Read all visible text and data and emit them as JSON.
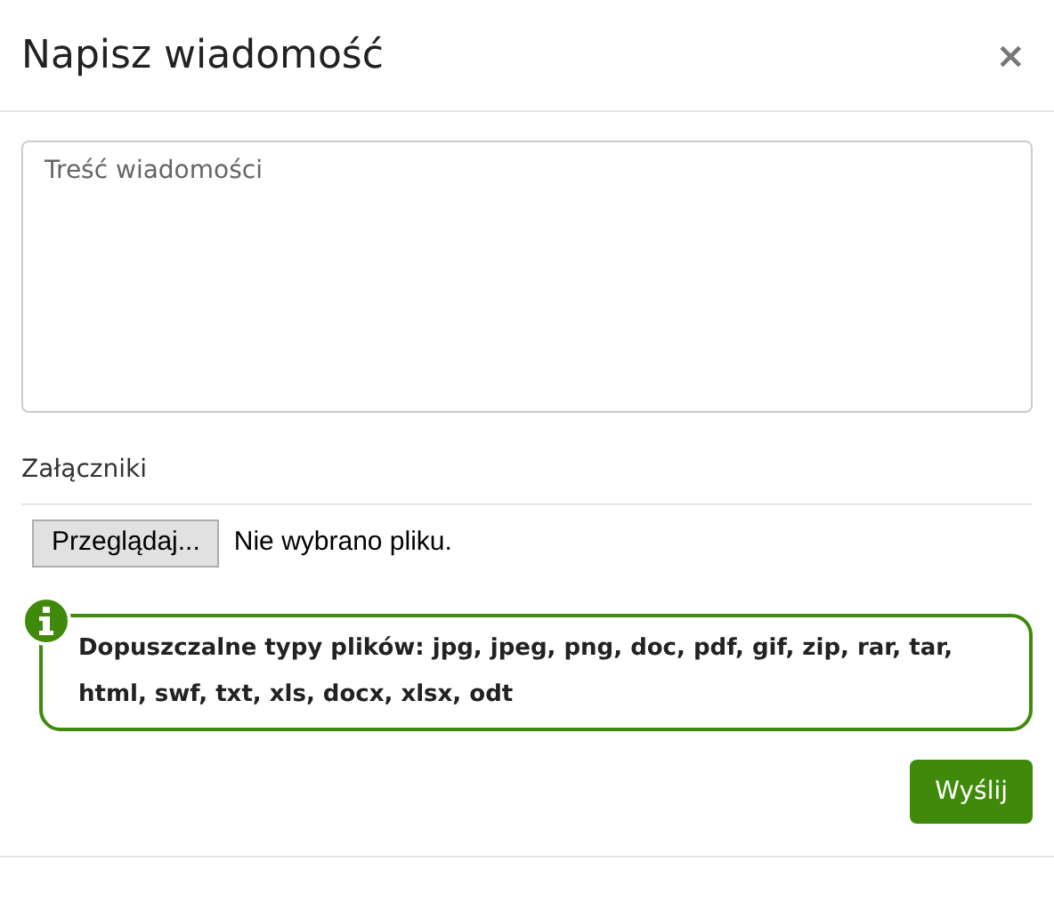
{
  "dialog": {
    "title": "Napisz wiadomość",
    "close": "×"
  },
  "message": {
    "placeholder": "Treść wiadomości"
  },
  "attachments": {
    "label": "Załączniki",
    "browse_button": "Przeglądaj...",
    "file_status": "Nie wybrano pliku."
  },
  "info": {
    "text": "Dopuszczalne typy plików: jpg, jpeg, png, doc, pdf, gif, zip, rar, tar, html, swf, txt, xls, docx, xlsx, odt"
  },
  "buttons": [
    "Wyślij"
  ]
}
